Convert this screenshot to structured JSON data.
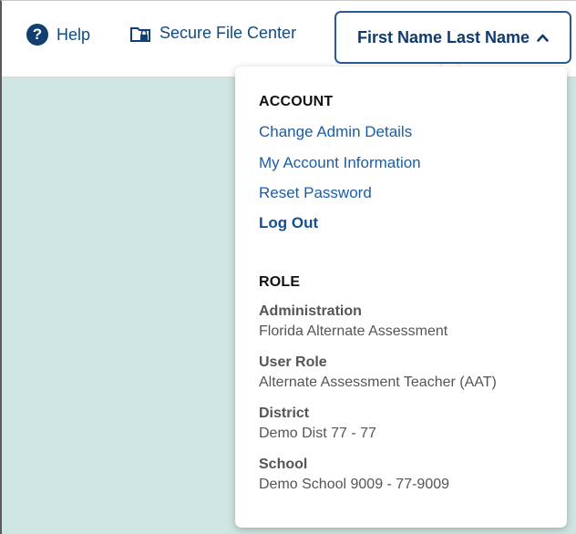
{
  "header": {
    "help_label": "Help",
    "help_icon": "question-circle-icon",
    "secure_file_label": "Secure File Center",
    "secure_file_icon": "folder-lock-icon",
    "user_name": "First Name Last Name",
    "user_caret_icon": "chevron-up-icon"
  },
  "account_menu": {
    "account_heading": "ACCOUNT",
    "links": [
      "Change Admin Details",
      "My Account Information",
      "Reset Password",
      "Log Out"
    ],
    "role_heading": "ROLE",
    "role_fields": [
      {
        "label": "Administration",
        "value": "Florida Alternate Assessment"
      },
      {
        "label": "User Role",
        "value": "Alternate Assessment Teacher (AAT)"
      },
      {
        "label": "District",
        "value": "Demo Dist 77 - 77"
      },
      {
        "label": "School",
        "value": "Demo School 9009 - 77-9009"
      }
    ]
  },
  "colors": {
    "brand": "#123f73",
    "link": "#1a5ea8",
    "content_background": "#cfe5e1"
  }
}
